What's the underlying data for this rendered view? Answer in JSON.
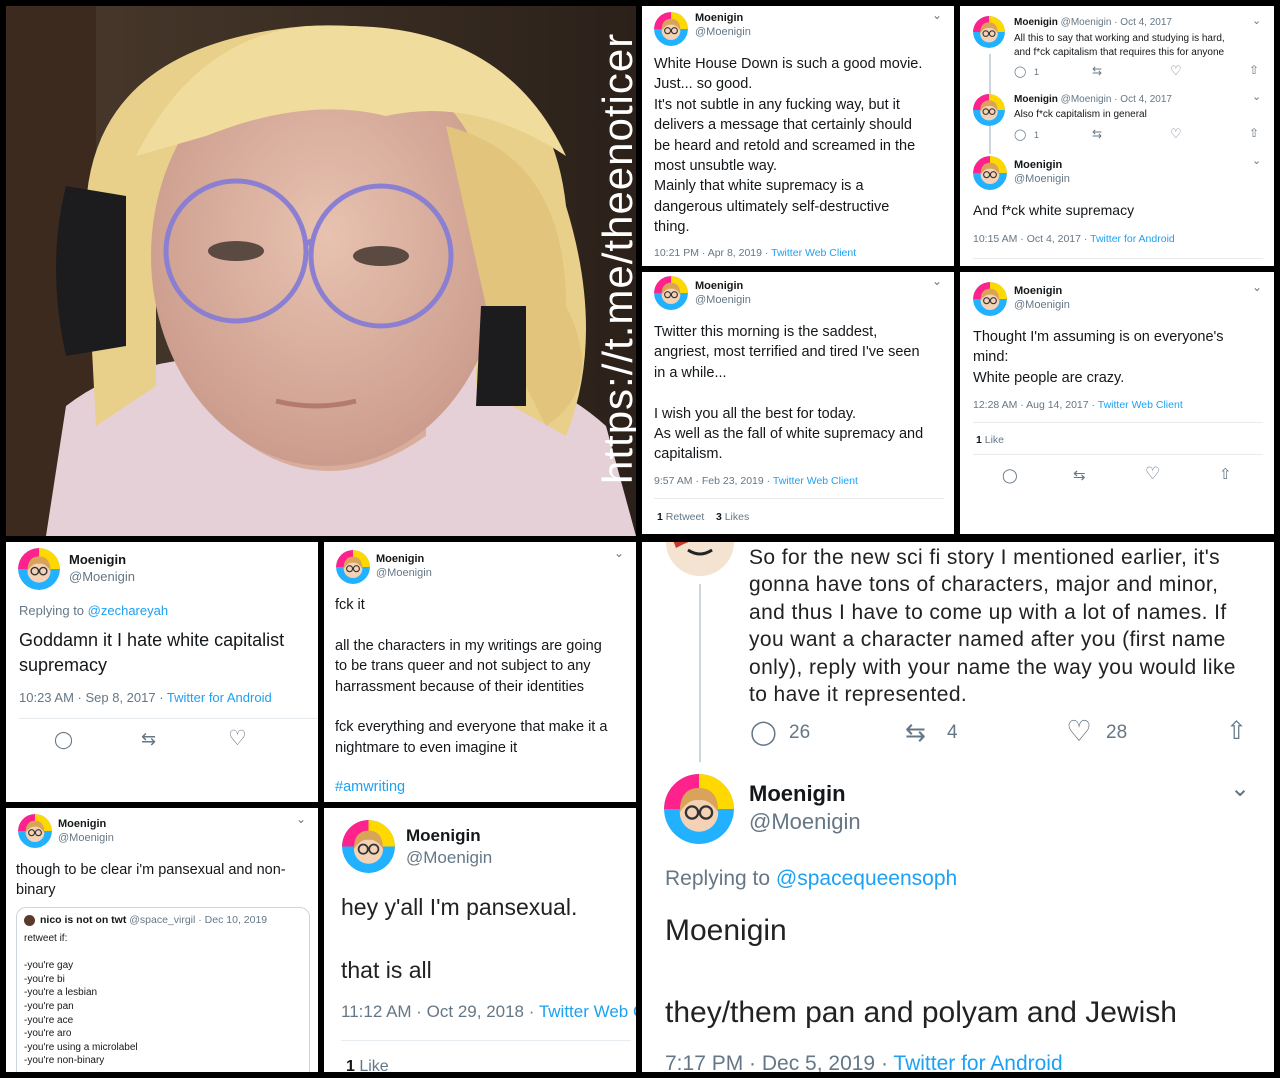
{
  "author": {
    "name": "Moenigin",
    "handle": "@Moenigin"
  },
  "watermark": "https://t.me/theenoticer",
  "tweet_house": {
    "lines": [
      "White House Down is such a good movie.",
      "Just... so good.",
      "It's not subtle in any fucking way, but it",
      "delivers a message that certainly should",
      "be heard and retold and screamed in the",
      "most unsubtle way.",
      "Mainly that white supremacy is a",
      "dangerous ultimately self-destructive",
      "thing."
    ],
    "time": "10:21 PM · Apr 8, 2019 · ",
    "client": "Twitter Web Client"
  },
  "thread_capitalism": {
    "t1_meta": " @Moenigin · Oct 4, 2017",
    "t1_lines": [
      "All this to say that working and studying is hard,",
      "and f*ck capitalism that requires this for anyone"
    ],
    "t1_reply_count": "1",
    "t2_meta": " @Moenigin · Oct 4, 2017",
    "t2_text": "Also f*ck capitalism in general",
    "t2_reply_count": "1",
    "t3_text": "And f*ck white supremacy",
    "t3_time": "10:15 AM · Oct 4, 2017 · ",
    "t3_client": "Twitter for Android"
  },
  "tweet_saddest": {
    "lines": [
      "Twitter this morning is the saddest,",
      "angriest, most terrified and tired I've seen",
      "in a while...",
      "",
      "I wish you all the best for today.",
      "As well as the fall of white supremacy and",
      "capitalism."
    ],
    "time": "9:57 AM · Feb 23, 2019 · ",
    "client": "Twitter Web Client",
    "retweets": "1",
    "retweets_label": " Retweet",
    "likes": "3",
    "likes_label": " Likes"
  },
  "tweet_crazy": {
    "lines": [
      "Thought I'm assuming is on everyone's",
      "mind:",
      "White people are crazy."
    ],
    "time": "12:28 AM · Aug 14, 2017 · ",
    "client": "Twitter Web Client",
    "likes": "1",
    "likes_label": " Like"
  },
  "tweet_goddamn": {
    "replying_label": "Replying to ",
    "replying_to": "@zechareyah",
    "lines": [
      "Goddamn it I hate white capitalist",
      "supremacy"
    ],
    "time": "10:23 AM · Sep 8, 2017 · ",
    "client": "Twitter for Android"
  },
  "tweet_fckit": {
    "lines": [
      "fck it",
      "",
      "all the characters in my writings are going",
      "to be trans queer and not subject to any",
      "harrassment because of their identities",
      "",
      "fck everything and everyone that make it a",
      "nightmare to even imagine it"
    ],
    "hashtag": "#amwriting"
  },
  "tweet_names": {
    "lines": [
      "So for the new sci fi story I mentioned earlier, it's",
      "gonna have tons of characters, major and minor,",
      "and thus I have to come up with a lot of names. If",
      "you want a character named after you (first name",
      "only), reply with your name the way you would like",
      "to have it represented."
    ],
    "replies": "26",
    "retweets": "4",
    "likes": "28",
    "replying_label": "Replying to ",
    "replying_to": "@spacequeensoph",
    "reply_lines": [
      "Moenigin",
      "",
      "they/them pan and polyam and Jewish"
    ],
    "time": "7:17 PM · Dec 5, 2019 · ",
    "client": "Twitter for Android"
  },
  "tweet_clear": {
    "lines": [
      "though to be clear i'm pansexual and non-",
      "binary"
    ],
    "quote_name": "nico is not on twt",
    "quote_meta": " @space_virgil · Dec 10, 2019",
    "quote_lines": [
      "retweet if:",
      "",
      "-you're gay",
      "-you're bi",
      "-you're a lesbian",
      "-you're pan",
      "-you're ace",
      "-you're aro",
      "-you're using a microlabel",
      "-you're non-binary"
    ]
  },
  "tweet_pan": {
    "lines": [
      "hey y'all I'm pansexual.",
      "",
      "that is all"
    ],
    "time": "11:12 AM · Oct 29, 2018 · ",
    "client": "Twitter Web C",
    "likes": "1",
    "likes_label": " Like"
  },
  "colors": {
    "link": "#1da1f2",
    "text": "#14171a",
    "muted": "#657786",
    "divider": "#e6ecf0",
    "pan_pink": "#ff218c",
    "pan_yellow": "#ffd800",
    "pan_blue": "#21b1ff"
  },
  "icons": [
    "reply-icon",
    "retweet-icon",
    "like-icon",
    "share-icon",
    "chevron-down-icon"
  ]
}
